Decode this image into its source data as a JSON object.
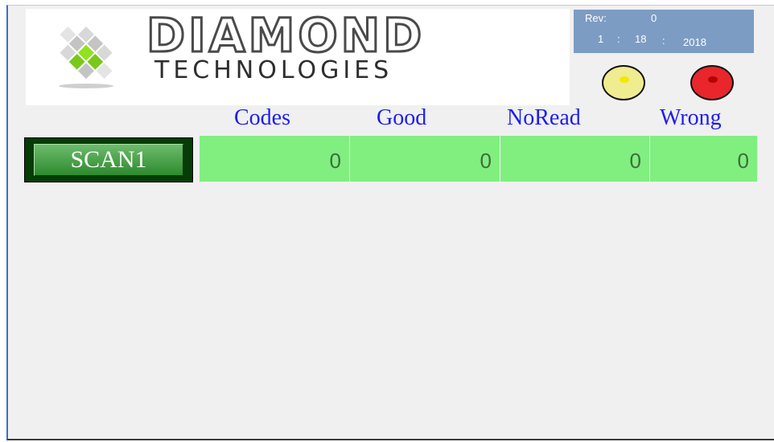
{
  "logo": {
    "top_text": "DIAMOND",
    "bottom_text": "TECHNOLOGIES",
    "icon": "diamond-cluster-logo",
    "colors": {
      "green": "#8fe31d",
      "gray": "#b8b8b8",
      "text": "#4a4a4a"
    }
  },
  "rev": {
    "label": "Rev:",
    "value": "0",
    "date_part1": "1",
    "sep1": ":",
    "date_part2": "18",
    "sep2": ":",
    "date_part3": "2018"
  },
  "lamps": [
    {
      "name": "yellow",
      "color": "#f0ec90"
    },
    {
      "name": "red",
      "color": "#e8262c"
    }
  ],
  "columns": [
    "Codes",
    "Good",
    "NoRead",
    "Wrong"
  ],
  "scan": {
    "label": "SCAN1",
    "values": {
      "codes": "0",
      "good": "0",
      "noread": "0",
      "wrong": "0"
    }
  },
  "colors": {
    "background": "#f0f0f0",
    "value_cell": "#80ef80",
    "header_text": "#1d1df0",
    "button_dark": "#063c06",
    "rev_box": "#7d9cc3"
  }
}
